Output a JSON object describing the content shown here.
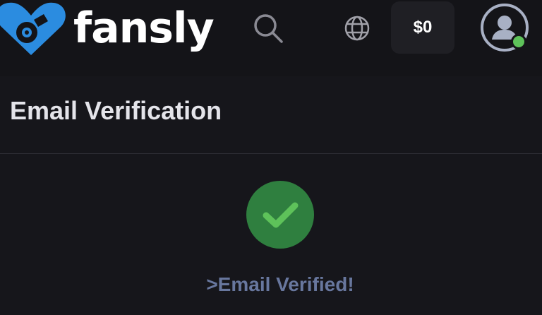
{
  "header": {
    "brand": "fansly",
    "wallet_balance": "$0",
    "icons": {
      "logo": "heart-lock-logo-icon",
      "search": "search-icon",
      "language": "globe-icon",
      "avatar": "user-avatar-icon",
      "online": "online-status-icon"
    }
  },
  "page": {
    "title": "Email Verification"
  },
  "status": {
    "icon": "check-icon",
    "message": ">Email Verified!"
  },
  "colors": {
    "brand_blue": "#2b8ce0",
    "success_green": "#2f7f3f",
    "check_green": "#5ec25a",
    "status_text": "#68779e",
    "background": "#16161b",
    "header_background": "#141418"
  }
}
